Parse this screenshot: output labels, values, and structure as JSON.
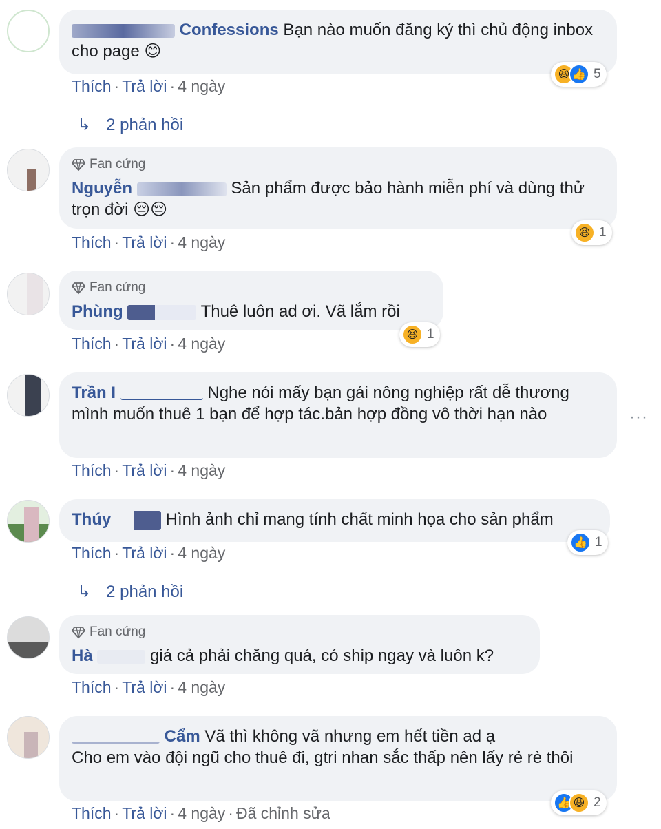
{
  "labels": {
    "like": "Thích",
    "reply": "Trả lời",
    "sep": "·",
    "fan_badge": "Fan cứng",
    "replies_count": "2 phản hồi",
    "edited": "Đã chỉnh sửa"
  },
  "comments": [
    {
      "author": "Confessions",
      "text": "Bạn nào muốn đăng ký thì chủ động inbox cho page 😊",
      "time": "4 ngày",
      "reactions": [
        "haha",
        "like"
      ],
      "reaction_count": "5",
      "replies": "2 phản hồi"
    },
    {
      "badge": "Fan cứng",
      "author": "Nguyễn",
      "text": "Sản phẩm được bảo hành miễn phí và dùng thử trọn đời 😔😔",
      "time": "4 ngày",
      "reactions": [
        "haha"
      ],
      "reaction_count": "1"
    },
    {
      "badge": "Fan cứng",
      "author": "Phùng",
      "text": "Thuê luôn ad ơi. Vã lắm rồi",
      "time": "4 ngày",
      "reactions": [
        "haha"
      ],
      "reaction_count": "1"
    },
    {
      "author": "Trần I",
      "text": "Nghe nói mấy bạn gái nông nghiệp rất dễ thương mình muốn thuê 1 bạn để hợp tác.bản hợp đồng vô thời hạn nào",
      "time": "4 ngày",
      "more": "···"
    },
    {
      "author": "Thúy",
      "text": "Hình ảnh chỉ mang tính chất minh họa cho sản phẩm",
      "time": "4 ngày",
      "reactions": [
        "like"
      ],
      "reaction_count": "1",
      "replies": "2 phản hồi"
    },
    {
      "badge": "Fan cứng",
      "author": "Hà",
      "text": "giá cả phải chăng quá, có ship ngay và luôn k?",
      "time": "4 ngày"
    },
    {
      "author": "Cẩm",
      "text_line1": "Vã thì không vã nhưng em hết tiền ad ạ",
      "text_line2": "Cho em vào đội ngũ cho thuê đi, gtri nhan sắc thấp nên lấy rẻ rè thôi",
      "time": "4 ngày",
      "edited": "Đã chỉnh sửa",
      "reactions": [
        "like",
        "haha"
      ],
      "reaction_count": "2"
    }
  ],
  "colors": {
    "link": "#385898",
    "meta": "#65676b",
    "bubble": "#f0f2f5",
    "like": "#1877f2",
    "haha": "#f7b125"
  },
  "icons": {
    "reply_arrow": "reply-arrow-icon",
    "badge": "diamond-icon",
    "like": "thumbs-up-icon",
    "haha": "laughing-face-icon",
    "more": "more-dots-icon"
  }
}
